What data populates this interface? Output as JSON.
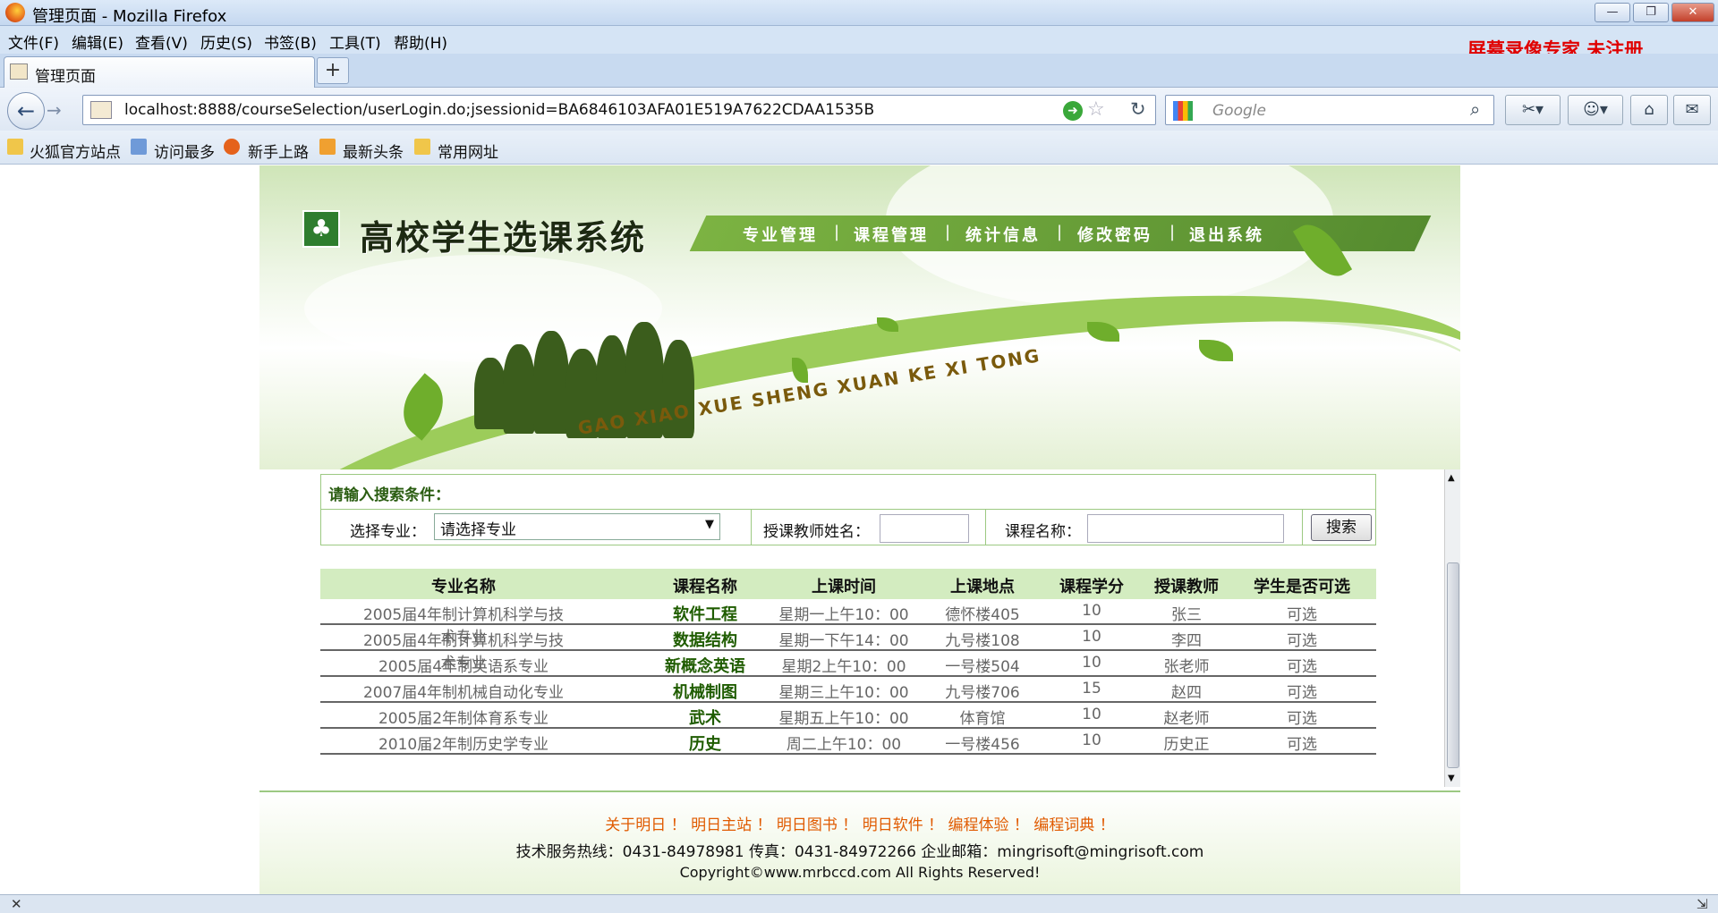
{
  "window": {
    "title": "管理页面 - Mozilla Firefox",
    "min": "—",
    "max": "❐",
    "close": "✕"
  },
  "menu": {
    "items": [
      "文件(F)",
      "编辑(E)",
      "查看(V)",
      "历史(S)",
      "书签(B)",
      "工具(T)",
      "帮助(H)"
    ]
  },
  "watermark": "屏幕录像专家  未注册",
  "tab": {
    "title": "管理页面",
    "new": "+"
  },
  "nav": {
    "url": "localhost:8888/courseSelection/userLogin.do;jsessionid=BA6846103AFA01E519A7622CDAA1535B",
    "search_placeholder": "Google"
  },
  "bookmarks": [
    "火狐官方站点",
    "访问最多",
    "新手上路",
    "最新头条",
    "常用网址"
  ],
  "site": {
    "title": "高校学生选课系统",
    "pinyin": "GAO XIAO XUE SHENG XUAN KE XI TONG",
    "logo": "♣",
    "menu": [
      "专业管理",
      "课程管理",
      "统计信息",
      "修改密码",
      "退出系统"
    ],
    "sep": "|"
  },
  "search": {
    "heading": "请输入搜索条件：",
    "major_label": "选择专业：",
    "major_value": "请选择专业",
    "teacher_label": "授课教师姓名：",
    "course_label": "课程名称：",
    "button": "搜索"
  },
  "table": {
    "headers": [
      "专业名称",
      "课程名称",
      "上课时间",
      "上课地点",
      "课程学分",
      "授课教师",
      "学生是否可选"
    ],
    "rows": [
      [
        "2005届4年制计算机科学与技术专业",
        "软件工程",
        "星期一上午10：00",
        "德怀楼405",
        "10",
        "张三",
        "可选"
      ],
      [
        "2005届4年制计算机科学与技术专业",
        "数据结构",
        "星期一下午14：00",
        "九号楼108",
        "10",
        "李四",
        "可选"
      ],
      [
        "2005届4年制英语系专业",
        "新概念英语",
        "星期2上午10：00",
        "一号楼504",
        "10",
        "张老师",
        "可选"
      ],
      [
        "2007届4年制机械自动化专业",
        "机械制图",
        "星期三上午10：00",
        "九号楼706",
        "15",
        "赵四",
        "可选"
      ],
      [
        "2005届2年制体育系专业",
        "武术",
        "星期五上午10：00",
        "体育馆",
        "10",
        "赵老师",
        "可选"
      ],
      [
        "2010届2年制历史学专业",
        "历史",
        "周二上午10：00",
        "一号楼456",
        "10",
        "历史正",
        "可选"
      ]
    ]
  },
  "footer": {
    "links": "关于明日 ！ 明日主站 ！ 明日图书 ！ 明日软件 ！ 编程体验 ！ 编程词典 ！",
    "contact": "技术服务热线：0431-84978981 传真：0431-84972266 企业邮箱：mingrisoft@mingrisoft.com",
    "copyright": "Copyright©www.mrbccd.com All Rights Reserved!"
  },
  "status": {
    "close": "✕",
    "resize": "⇲"
  },
  "colors": {
    "accent_green": "#558b2f",
    "watermark_red": "#e00000",
    "link_orange": "#e05a00"
  }
}
